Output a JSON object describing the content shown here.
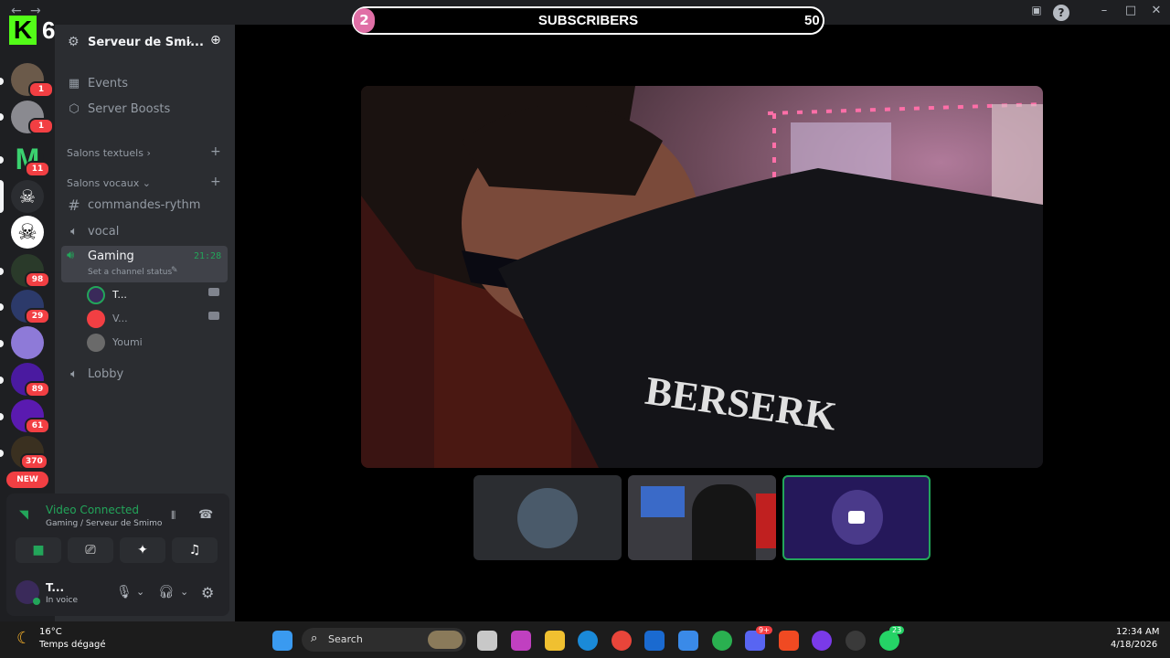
{
  "window": {
    "title": "Serveur de Smimo",
    "back": "←",
    "forward": "→"
  },
  "overlay": {
    "kick_logo": "K",
    "kick_count": "6",
    "subscribers_current": "2",
    "subscribers_label": "SUBSCRIBERS",
    "subscribers_goal": "50"
  },
  "rail": {
    "badges": [
      "1",
      "1",
      "11",
      "98",
      "29",
      "89",
      "61",
      "370"
    ],
    "new_label": "NEW"
  },
  "server": {
    "name": "Serveur de Smi...",
    "events": "Events",
    "boosts": "Server Boosts",
    "text_category": "Salons textuels",
    "voice_category": "Salons vocaux",
    "channels": {
      "commandes": "commandes-rythm",
      "vocal": "vocal",
      "gaming": "Gaming",
      "gaming_time": "21:28",
      "gaming_status": "Set a channel status",
      "lobby": "Lobby"
    },
    "voice_users": [
      "T...",
      "V...",
      "Youmi"
    ]
  },
  "voice_panel": {
    "status": "Video Connected",
    "location": "Gaming / Serveur de Smimo"
  },
  "user": {
    "name": "T...",
    "status": "In voice"
  },
  "taskbar": {
    "weather_temp": "16°C",
    "weather_desc": "Temps dégagé",
    "search": "Search",
    "discord_badge": "9+",
    "whatsapp_badge": "23",
    "time": "12:34 AM",
    "date": "4/18/2026"
  },
  "colors": {
    "accent_green": "#23a55a",
    "badge_red": "#f23f43",
    "subs_pink": "#e06fa6",
    "kick_green": "#53fc18"
  }
}
